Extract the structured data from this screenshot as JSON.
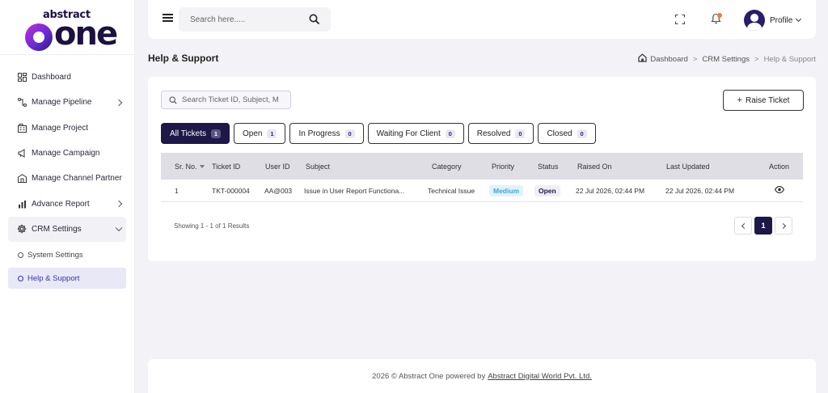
{
  "logo": {
    "top_text": "abstract",
    "main_text": "one"
  },
  "sidebar": {
    "items": [
      {
        "label": "Dashboard",
        "icon": "dashboard-icon"
      },
      {
        "label": "Manage Pipeline",
        "icon": "pipeline-icon"
      },
      {
        "label": "Manage Project",
        "icon": "project-icon"
      },
      {
        "label": "Manage Campaign",
        "icon": "campaign-icon"
      },
      {
        "label": "Manage Channel Partner",
        "icon": "partner-icon"
      },
      {
        "label": "Advance Report",
        "icon": "report-icon"
      },
      {
        "label": "CRM Settings",
        "icon": "gear-icon"
      }
    ],
    "sub_items": [
      {
        "label": "System Settings"
      },
      {
        "label": "Help & Support"
      }
    ]
  },
  "header": {
    "search_placeholder": "Search here.....",
    "profile_label": "Profile"
  },
  "page": {
    "title": "Help & Support",
    "breadcrumb": [
      "Dashboard",
      "CRM Settings",
      "Help & Support"
    ],
    "breadcrumb_sep": ">"
  },
  "toolbar": {
    "ticket_search_placeholder": "Search Ticket ID, Subject, M",
    "raise_ticket_label": "Raise Ticket"
  },
  "tabs": [
    {
      "label": "All Tickets",
      "count": "1"
    },
    {
      "label": "Open",
      "count": "1"
    },
    {
      "label": "In Progress",
      "count": "0"
    },
    {
      "label": "Waiting For Client",
      "count": "0"
    },
    {
      "label": "Resolved",
      "count": "0"
    },
    {
      "label": "Closed",
      "count": "0"
    }
  ],
  "table": {
    "columns": [
      "Sr. No.",
      "Ticket ID",
      "User ID",
      "Subject",
      "Category",
      "Priority",
      "Status",
      "Raised On",
      "Last Updated",
      "Action"
    ],
    "rows": [
      {
        "sr": "1",
        "ticket_id": "TKT-000004",
        "user_id": "AA@003",
        "subject": "Issue in User Report Functiona...",
        "category": "Technical Issue",
        "priority": "Medium",
        "status": "Open",
        "raised_on": "22 Jul 2026, 02:44 PM",
        "last_updated": "22 Jul 2026, 02:44 PM"
      }
    ]
  },
  "pagination": {
    "showing": "Showing 1 - 1 of 1 Results",
    "current_page": "1"
  },
  "footer": {
    "text": "2026 © Abstract One powered by",
    "link": "Abstract Digital World Pvt. Ltd."
  }
}
